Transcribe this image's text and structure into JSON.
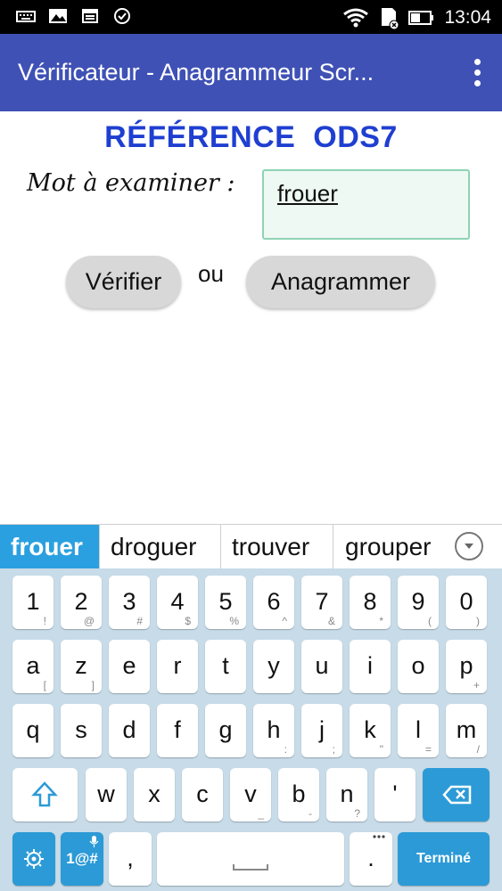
{
  "status_bar": {
    "time": "13:04"
  },
  "app_bar": {
    "title": "Vérificateur - Anagrammeur Scr..."
  },
  "main": {
    "reference_title": "RÉFÉRENCE  ODS7",
    "word_label": "Mot à examiner :",
    "word_value": "frouer",
    "verify_button": "Vérifier",
    "or_text": "ou",
    "anagram_button": "Anagrammer"
  },
  "keyboard": {
    "suggestions": [
      "frouer",
      "droguer",
      "trouver",
      "grouper"
    ],
    "row_numbers": [
      {
        "m": "1",
        "h": "!"
      },
      {
        "m": "2",
        "h": "@"
      },
      {
        "m": "3",
        "h": "#"
      },
      {
        "m": "4",
        "h": "$"
      },
      {
        "m": "5",
        "h": "%"
      },
      {
        "m": "6",
        "h": "^"
      },
      {
        "m": "7",
        "h": "&"
      },
      {
        "m": "8",
        "h": "*"
      },
      {
        "m": "9",
        "h": "("
      },
      {
        "m": "0",
        "h": ")"
      }
    ],
    "row_1": [
      {
        "m": "a",
        "h": "["
      },
      {
        "m": "z",
        "h": "]"
      },
      {
        "m": "e",
        "h": ""
      },
      {
        "m": "r",
        "h": ""
      },
      {
        "m": "t",
        "h": ""
      },
      {
        "m": "y",
        "h": ""
      },
      {
        "m": "u",
        "h": ""
      },
      {
        "m": "i",
        "h": ""
      },
      {
        "m": "o",
        "h": ""
      },
      {
        "m": "p",
        "h": "+"
      }
    ],
    "row_2": [
      {
        "m": "q",
        "h": ""
      },
      {
        "m": "s",
        "h": ""
      },
      {
        "m": "d",
        "h": ""
      },
      {
        "m": "f",
        "h": ""
      },
      {
        "m": "g",
        "h": ""
      },
      {
        "m": "h",
        "h": ":"
      },
      {
        "m": "j",
        "h": ";"
      },
      {
        "m": "k",
        "h": "\""
      },
      {
        "m": "l",
        "h": "="
      },
      {
        "m": "m",
        "h": "/"
      }
    ],
    "row_3": [
      {
        "m": "w",
        "h": ""
      },
      {
        "m": "x",
        "h": ""
      },
      {
        "m": "c",
        "h": ""
      },
      {
        "m": "v",
        "h": "_"
      },
      {
        "m": "b",
        "h": "-"
      },
      {
        "m": "n",
        "h": "?"
      },
      {
        "m": "'",
        "h": ""
      }
    ],
    "symbols_key": "1@#",
    "comma_key": ",",
    "period_key": ".",
    "done_key": "Terminé",
    "icons": {
      "shift": "shift-icon",
      "backspace": "backspace-icon",
      "settings": "gear-icon",
      "space": "space-icon",
      "mic": "microphone-icon"
    },
    "accent_color": "#2c9ad6"
  }
}
